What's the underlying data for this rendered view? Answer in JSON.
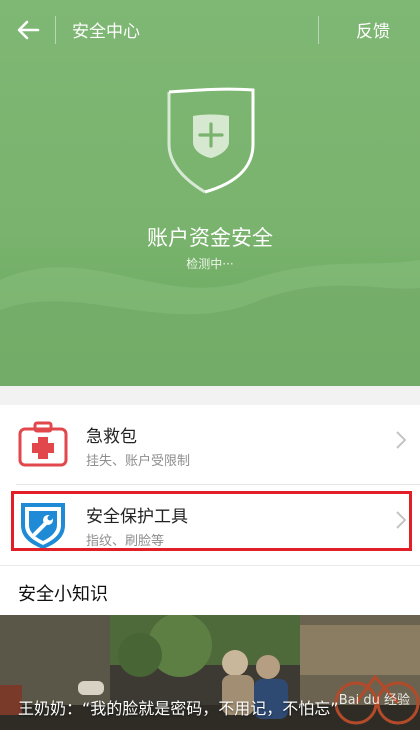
{
  "header": {
    "title": "安全中心",
    "feedback": "反馈",
    "back_icon": "arrow-left-icon"
  },
  "hero": {
    "title": "账户资金安全",
    "status": "检测中···",
    "shield_icon": "shield-plus-icon",
    "colors": {
      "background": "#79b36d",
      "shield_fill": "#d6e9d0"
    }
  },
  "menu": {
    "items": [
      {
        "title": "急救包",
        "subtitle": "挂失、账户受限制",
        "icon": "first-aid-kit-icon",
        "color": "#e2474b"
      },
      {
        "title": "安全保护工具",
        "subtitle": "指纹、刷脸等",
        "icon": "shield-wrench-icon",
        "color": "#1f8bd6"
      }
    ]
  },
  "knowledge": {
    "heading": "安全小知识",
    "caption": "王奶奶：“我的脸就是密码，不用记，不怕忘”",
    "watermark": "Bai du 经验"
  }
}
